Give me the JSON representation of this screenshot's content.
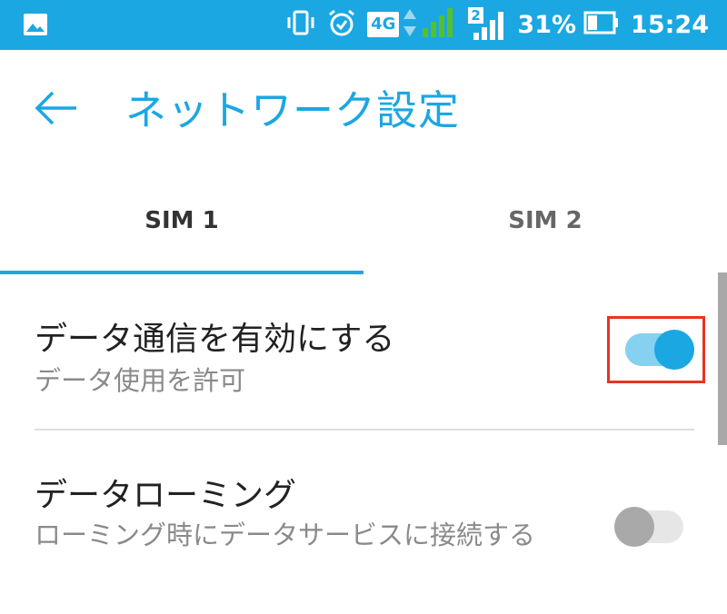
{
  "status_bar": {
    "network_type": "4G",
    "sim2_label": "2",
    "battery_percent": "31%",
    "time": "15:24",
    "icons": [
      "image-icon",
      "vibrate-icon",
      "alarm-icon",
      "network-4g-icon",
      "data-arrows-icon",
      "signal-sim1-icon",
      "signal-sim2-icon",
      "battery-icon"
    ]
  },
  "app_bar": {
    "title": "ネットワーク設定",
    "back_icon": "back-arrow-icon"
  },
  "tabs": [
    {
      "label": "SIM 1",
      "selected": true
    },
    {
      "label": "SIM 2",
      "selected": false
    }
  ],
  "preferences": [
    {
      "title": "データ通信を有効にする",
      "summary": "データ使用を許可",
      "enabled": true
    },
    {
      "title": "データローミング",
      "summary": "ローミング時にデータサービスに接続する",
      "enabled": false
    }
  ],
  "colors": {
    "accent": "#1ba7e2",
    "track_on": "#86d0f0",
    "track_off": "#e6e6e6",
    "thumb_off": "#a9a9a9",
    "highlight": "#e8341f"
  }
}
